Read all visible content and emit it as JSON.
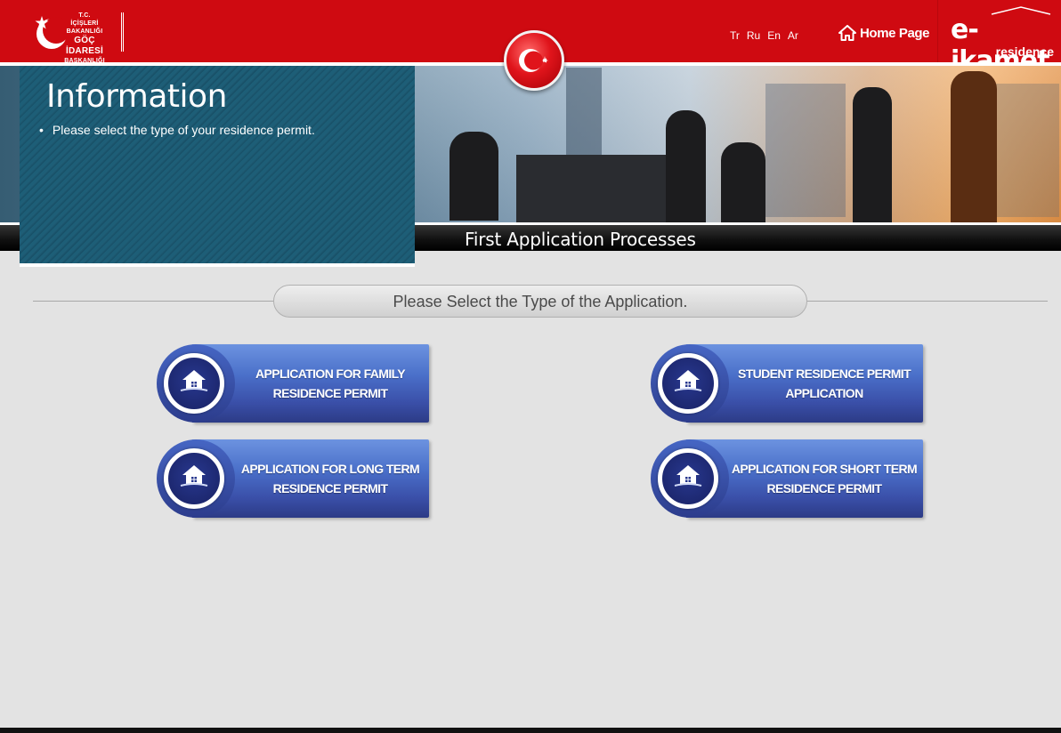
{
  "header": {
    "logo": {
      "line1": "T.C.",
      "line2": "İÇİŞLERİ BAKANLIĞI",
      "line3": "GÖÇ İDARESİ",
      "line4": "BAŞKANLIĞI"
    },
    "languages": [
      "Tr",
      "Ru",
      "En",
      "Ar"
    ],
    "home_label": "Home Page",
    "brand_main": "e-ikamet",
    "brand_sub": "residence",
    "accent_color": "#cf0a11"
  },
  "info": {
    "title": "Information",
    "items": [
      "Please select the type of your residence permit."
    ]
  },
  "process_title": "First Application Processes",
  "section_heading": "Please Select the Type of the Application.",
  "applications": [
    {
      "line1": "APPLICATION FOR FAMILY",
      "line2": "RESIDENCE PERMIT",
      "icon": "house-icon"
    },
    {
      "line1": "STUDENT RESIDENCE PERMIT",
      "line2": "APPLICATION",
      "icon": "house-icon"
    },
    {
      "line1": "APPLICATION FOR LONG TERM",
      "line2": "RESIDENCE PERMIT",
      "icon": "house-icon"
    },
    {
      "line1": "APPLICATION FOR SHORT TERM",
      "line2": "RESIDENCE PERMIT",
      "icon": "house-icon"
    }
  ]
}
